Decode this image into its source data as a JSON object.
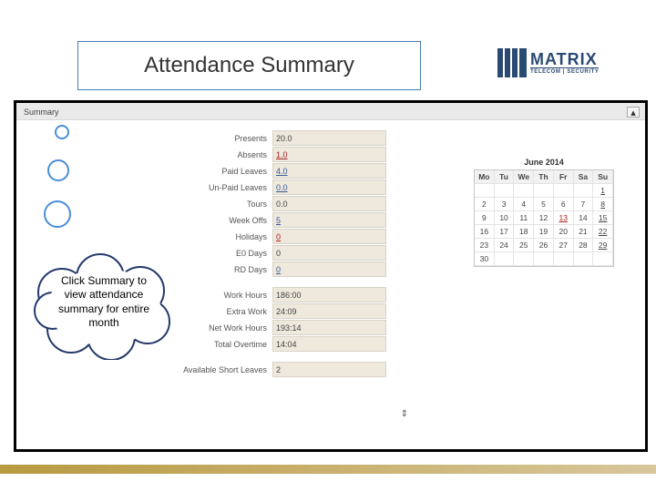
{
  "title": "Attendance Summary",
  "logo": {
    "main": "MATRIX",
    "sub": "TELECOM | SECURITY"
  },
  "tab_label": "Summary",
  "collapse_glyph": "▴",
  "summary_rows": [
    {
      "label": "Presents",
      "value": "20.0",
      "link": false,
      "red": false
    },
    {
      "label": "Absents",
      "value": "1.0",
      "link": false,
      "red": true
    },
    {
      "label": "Paid Leaves",
      "value": "4.0",
      "link": true,
      "red": false
    },
    {
      "label": "Un-Paid Leaves",
      "value": "0.0",
      "link": true,
      "red": false
    },
    {
      "label": "Tours",
      "value": "0.0",
      "link": false,
      "red": false
    },
    {
      "label": "Week Offs",
      "value": "5",
      "link": true,
      "red": false
    },
    {
      "label": "Holidays",
      "value": "0",
      "link": false,
      "red": true
    },
    {
      "label": "E0 Days",
      "value": "0",
      "link": false,
      "red": false
    },
    {
      "label": "RD Days",
      "value": "0",
      "link": true,
      "red": false
    }
  ],
  "hour_rows": [
    {
      "label": "Work Hours",
      "value": "186:00"
    },
    {
      "label": "Extra Work",
      "value": "24:09"
    },
    {
      "label": "Net Work Hours",
      "value": "193:14"
    },
    {
      "label": "Total Overtime",
      "value": "14:04"
    }
  ],
  "last_row": {
    "label": "Available Short Leaves",
    "value": "2"
  },
  "calendar": {
    "title": "June 2014",
    "headers": [
      "Mo",
      "Tu",
      "We",
      "Th",
      "Fr",
      "Sa",
      "Su"
    ],
    "weeks": [
      [
        "",
        "",
        "",
        "",
        "",
        "",
        "1"
      ],
      [
        "2",
        "3",
        "4",
        "5",
        "6",
        "7",
        "8"
      ],
      [
        "9",
        "10",
        "11",
        "12",
        "13",
        "14",
        "15"
      ],
      [
        "16",
        "17",
        "18",
        "19",
        "20",
        "21",
        "22"
      ],
      [
        "23",
        "24",
        "25",
        "26",
        "27",
        "28",
        "29"
      ],
      [
        "30",
        "",
        "",
        "",
        "",
        "",
        ""
      ]
    ],
    "today": "13",
    "marked_col": 6
  },
  "cloud_text": "Click Summary to view attendance summary for entire month",
  "resize_glyph": "⇕"
}
